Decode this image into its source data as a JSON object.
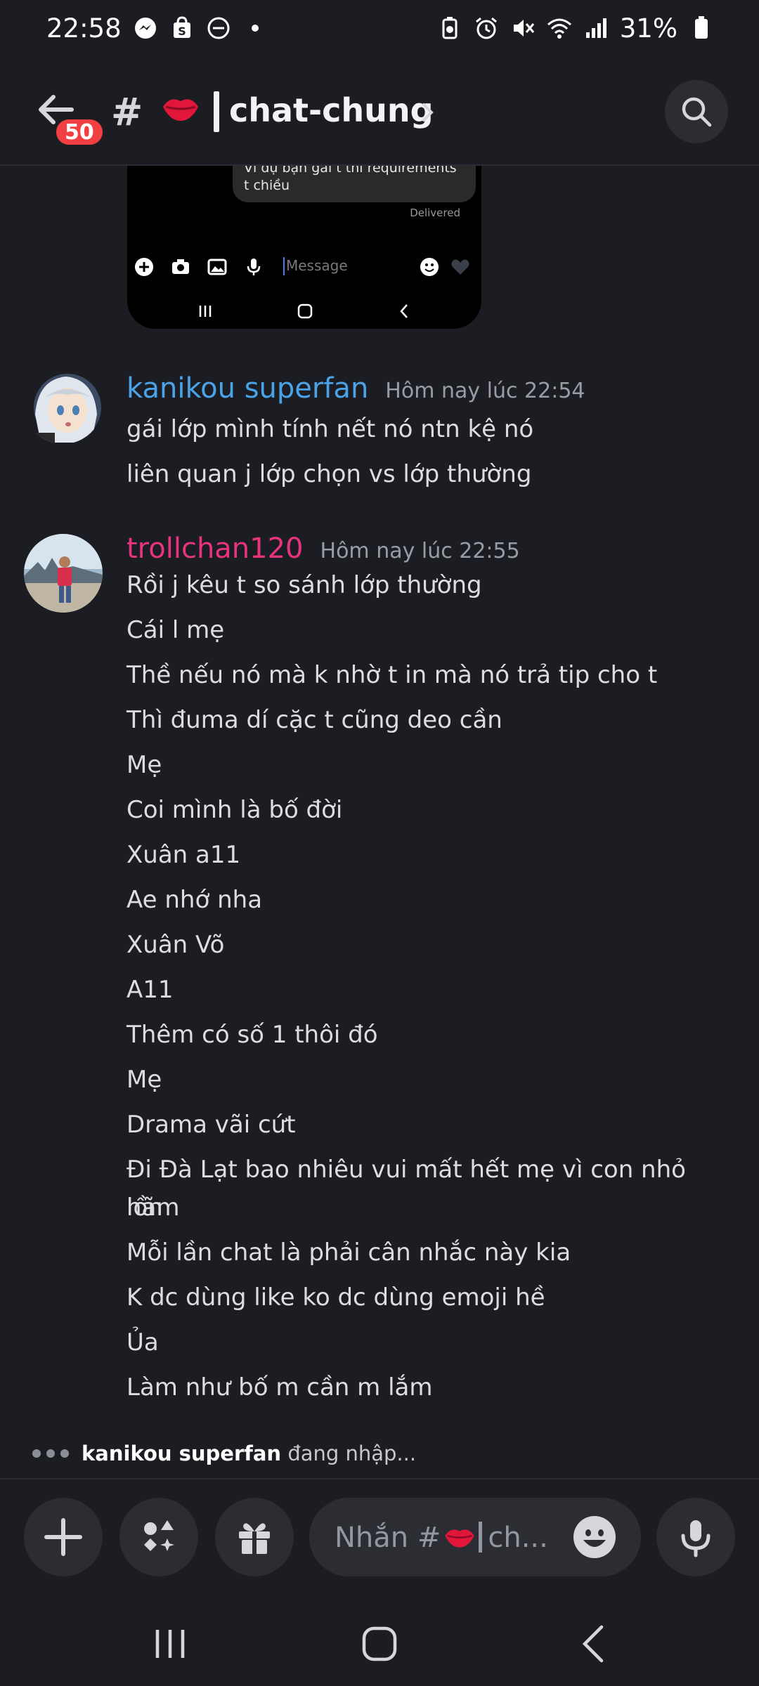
{
  "status_bar": {
    "time": "22:58",
    "battery": "31%",
    "left_icons": [
      "messenger-icon",
      "shop-icon",
      "dnd-icon",
      "dot-icon"
    ],
    "right_icons": [
      "battery-saver-icon",
      "alarm-icon",
      "mute-icon",
      "wifi-icon",
      "signal-icon",
      "battery-icon"
    ]
  },
  "header": {
    "unread_count": "50",
    "channel_prefix": "#",
    "channel_name": "chat-chung"
  },
  "embed": {
    "bubble_text_1": "Ví dụ bạn gái t thi requirements gì",
    "bubble_text_2": "t chiều",
    "delivered": "Delivered",
    "input_placeholder": "Message"
  },
  "messages": [
    {
      "author": "kanikou superfan",
      "author_color": "#4aa3e8",
      "time": "Hôm nay lúc 22:54",
      "lines": [
        "gái lớp mình tính nết nó ntn kệ nó",
        "liên quan j lớp chọn vs lớp thường"
      ]
    },
    {
      "author": "trollchan120",
      "author_color": "#e8347a",
      "time": "Hôm nay lúc 22:55",
      "lines": [
        "Rồi j kêu t so sánh lớp thường",
        "Cái l mẹ",
        "Thề nếu nó mà k nhờ t in mà nó trả tip cho t",
        "Thì đuma dí cặc t cũng deo cần",
        "Mẹ",
        "Coi mình là bố đời",
        "Xuân a11",
        "Ae nhớ nha",
        "Xuân Võ",
        "A11",
        "Thêm có số 1 thôi đó",
        "Mẹ",
        "Drama vãi cứt",
        "Đi Đà Lạt bao nhiêu vui mất hết mẹ vì con nhỏ hãm",
        "lồn",
        "Mỗi lần chat là phải cân nhắc này kia",
        "K dc dùng like ko dc dùng emoji hề",
        "Ủa",
        "Làm như bố m cần m lắm"
      ]
    }
  ],
  "typing": {
    "user": "kanikou superfan",
    "text": "đang nhập..."
  },
  "composer": {
    "placeholder_prefix": "Nhắn #",
    "placeholder_suffix": "ch...",
    "buttons": [
      "plus-icon",
      "apps-icon",
      "gift-icon",
      "mic-icon"
    ]
  },
  "colors": {
    "background": "#1c1d22",
    "surface": "#2b2d33",
    "badge": "#f23f42"
  }
}
